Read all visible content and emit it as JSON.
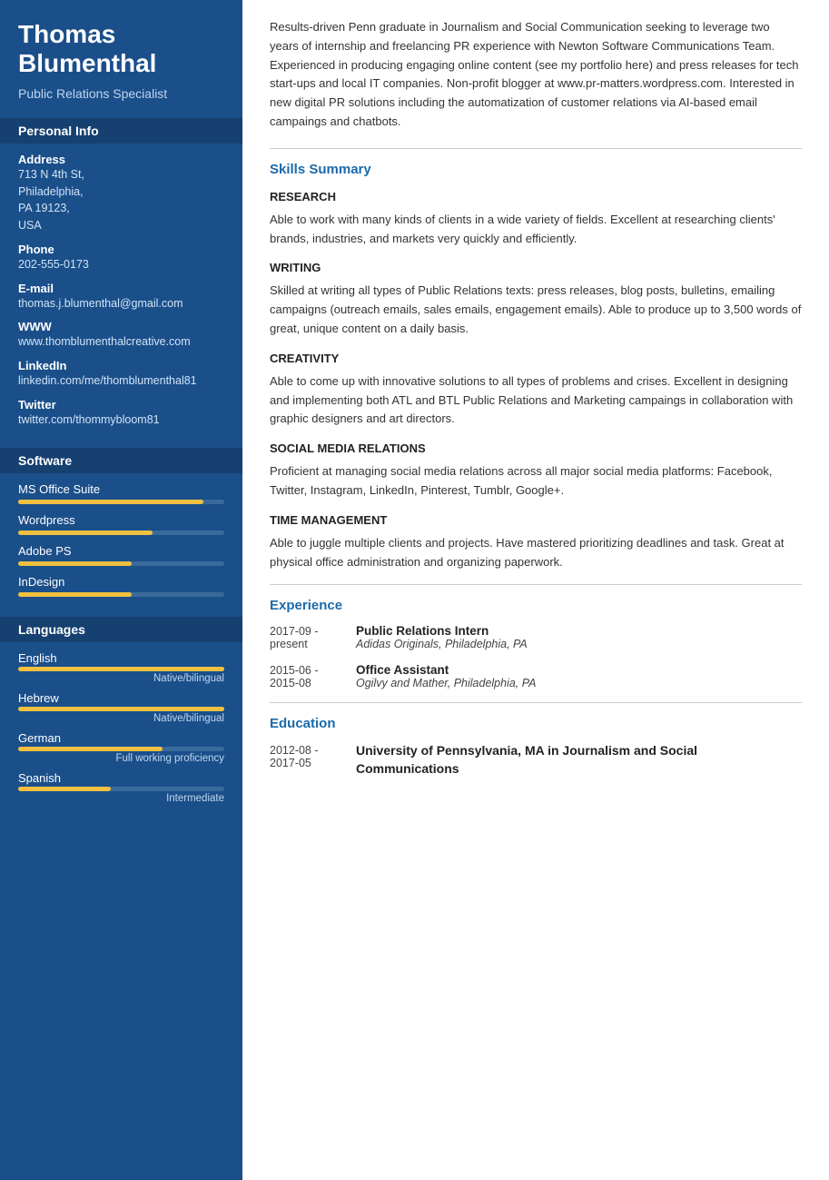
{
  "sidebar": {
    "name": "Thomas Blumenthal",
    "title": "Public Relations Specialist",
    "personal_info_heading": "Personal Info",
    "address_label": "Address",
    "address_value": "713 N 4th St,\nPhiladelphia,\nPA 19123,\nUSA",
    "phone_label": "Phone",
    "phone_value": "202-555-0173",
    "email_label": "E-mail",
    "email_value": "thomas.j.blumenthal@gmail.com",
    "www_label": "WWW",
    "www_value": "www.thomblumenthalcreative.com",
    "linkedin_label": "LinkedIn",
    "linkedin_value": "linkedin.com/me/thomblumenthal81",
    "twitter_label": "Twitter",
    "twitter_value": "twitter.com/thommybloom81",
    "software_heading": "Software",
    "software_items": [
      {
        "name": "MS Office Suite",
        "pct": 90
      },
      {
        "name": "Wordpress",
        "pct": 65
      },
      {
        "name": "Adobe PS",
        "pct": 55
      },
      {
        "name": "InDesign",
        "pct": 55
      }
    ],
    "languages_heading": "Languages",
    "language_items": [
      {
        "name": "English",
        "pct": 100,
        "level": "Native/bilingual"
      },
      {
        "name": "Hebrew",
        "pct": 100,
        "level": "Native/bilingual"
      },
      {
        "name": "German",
        "pct": 70,
        "level": "Full working proficiency"
      },
      {
        "name": "Spanish",
        "pct": 45,
        "level": "Intermediate"
      }
    ]
  },
  "main": {
    "summary": "Results-driven Penn graduate in Journalism and Social Communication seeking to leverage two years of internship and freelancing PR experience with Newton Software Communications Team. Experienced in producing engaging online content (see my portfolio here) and press releases for tech start-ups and local IT companies. Non-profit blogger at www.pr-matters.wordpress.com. Interested in new digital PR solutions including the automatization of customer relations via AI-based email campaings and chatbots.",
    "skills_heading": "Skills Summary",
    "skills": [
      {
        "category": "RESEARCH",
        "desc": "Able to work with many kinds of clients in a wide variety of fields. Excellent at researching clients' brands, industries, and markets very quickly and efficiently."
      },
      {
        "category": "WRITING",
        "desc": "Skilled at writing all types of Public Relations texts: press releases, blog posts, bulletins, emailing campaigns (outreach emails, sales emails, engagement emails). Able to produce up to 3,500 words of great, unique content on a daily basis."
      },
      {
        "category": "CREATIVITY",
        "desc": "Able to come up with innovative solutions to all types of problems and crises. Excellent in designing and implementing both ATL and BTL Public Relations and Marketing campaings in collaboration with graphic designers and art directors."
      },
      {
        "category": "SOCIAL MEDIA RELATIONS",
        "desc": "Proficient at managing social media relations across all major social media platforms: Facebook, Twitter, Instagram, LinkedIn, Pinterest, Tumblr, Google+."
      },
      {
        "category": "TIME MANAGEMENT",
        "desc": "Able to juggle multiple clients and projects. Have mastered prioritizing deadlines and task. Great at physical office administration and organizing paperwork."
      }
    ],
    "experience_heading": "Experience",
    "experience_items": [
      {
        "date": "2017-09 -\npresent",
        "title": "Public Relations Intern",
        "company": "Adidas Originals, Philadelphia, PA"
      },
      {
        "date": "2015-06 -\n2015-08",
        "title": "Office Assistant",
        "company": "Ogilvy and Mather, Philadelphia, PA"
      }
    ],
    "education_heading": "Education",
    "education_items": [
      {
        "date": "2012-08 -\n2017-05",
        "degree": "University of Pennsylvania, MA in Journalism and Social Communications"
      }
    ]
  }
}
